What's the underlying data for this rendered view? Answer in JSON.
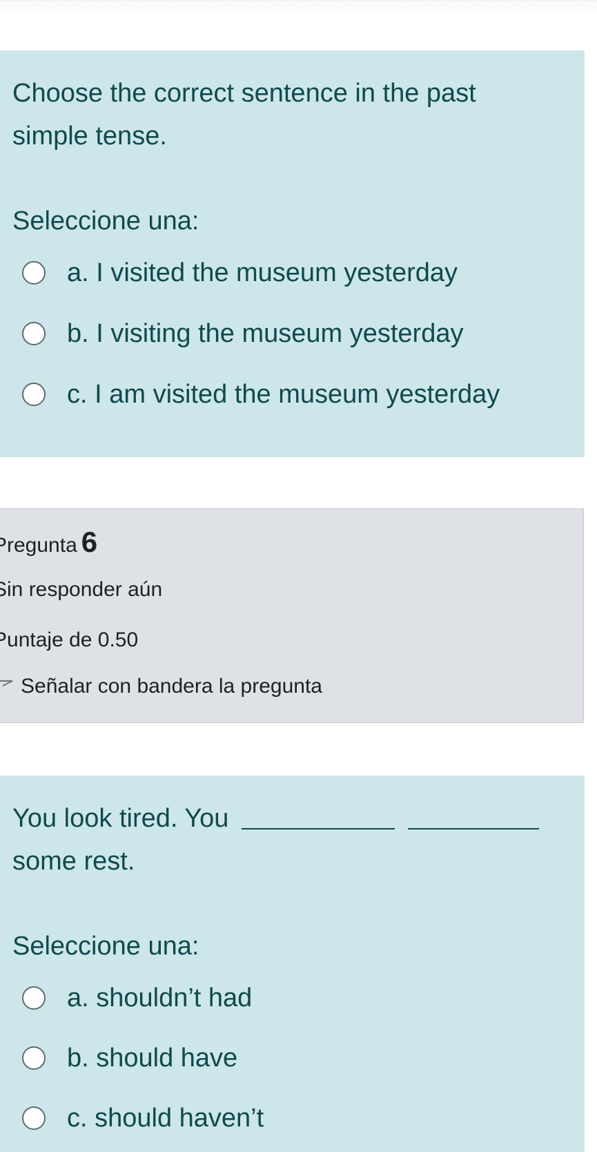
{
  "question5": {
    "text": "Choose the correct sentence in the past simple tense.",
    "prompt": "Seleccione una:",
    "options": [
      {
        "label": "a. I visited the museum yesterday"
      },
      {
        "label": "b. I visiting the museum yesterday"
      },
      {
        "label": "c. I am visited the museum yesterday"
      }
    ]
  },
  "question6_info": {
    "heading_prefix": "Pregunta",
    "number": "6",
    "status": "Sin responder aún",
    "score": "Puntaje de 0.50",
    "flag_label": "Señalar con bandera la pregunta"
  },
  "question6": {
    "text_before_blank": "You look tired. You",
    "text_after_blank": "some rest.",
    "prompt": "Seleccione una:",
    "options": [
      {
        "label": "a. shouldn’t had"
      },
      {
        "label": "b. should have"
      },
      {
        "label": "c. should haven’t"
      }
    ]
  },
  "colors": {
    "question_bg": "#cde6ea",
    "question_text": "#0f4a4d",
    "info_bg": "#dee2e6"
  }
}
